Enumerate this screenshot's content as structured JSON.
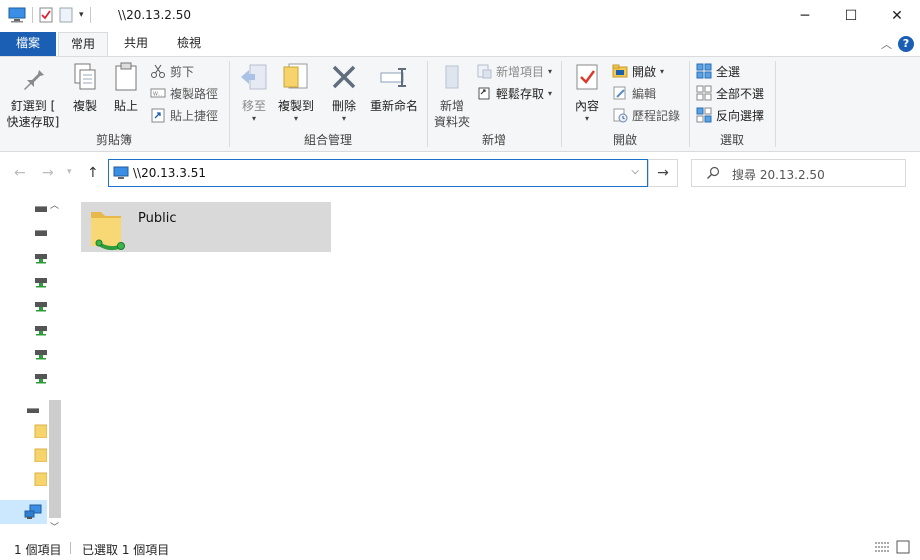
{
  "window": {
    "title": "\\\\20.13.2.50",
    "minimize_glyph": "─",
    "maximize_glyph": "☐",
    "close_glyph": "✕"
  },
  "tabs": [
    {
      "label": "檔案"
    },
    {
      "label": "常用"
    },
    {
      "label": "共用"
    },
    {
      "label": "檢視"
    }
  ],
  "ribbon": {
    "clipboard": {
      "label": "剪貼簿",
      "pin_label_1": "釘選到 [",
      "pin_label_2": "快速存取]",
      "copy_label": "複製",
      "paste_label": "貼上",
      "cut_label": "剪下",
      "copy_path_label": "複製路徑",
      "paste_shortcut_label": "貼上捷徑"
    },
    "organize": {
      "label": "組合管理",
      "move_label": "移至",
      "copy_to_label": "複製到",
      "delete_label": "刪除",
      "rename_label": "重新命名"
    },
    "new": {
      "label": "新增",
      "new_folder_label_1": "新增",
      "new_folder_label_2": "資料夾",
      "new_item_label": "新增項目",
      "easy_access_label": "輕鬆存取"
    },
    "open": {
      "label": "開啟",
      "properties_label": "內容",
      "open_label": "開啟",
      "edit_label": "編輯",
      "history_label": "歷程記錄"
    },
    "select": {
      "label": "選取",
      "select_all_label": "全選",
      "select_none_label": "全部不選",
      "invert_label": "反向選擇"
    }
  },
  "address": {
    "path": "\\\\20.13.3.51"
  },
  "search": {
    "placeholder": "搜尋 20.13.2.50"
  },
  "content": {
    "items": [
      {
        "name": "Public",
        "selected": true
      }
    ]
  },
  "status": {
    "item_count": "1 個項目",
    "selected_count": "已選取 1 個項目"
  },
  "colors": {
    "accent": "#1a5fb4",
    "selection": "#d9d9d9",
    "address_border": "#1a73c9"
  }
}
